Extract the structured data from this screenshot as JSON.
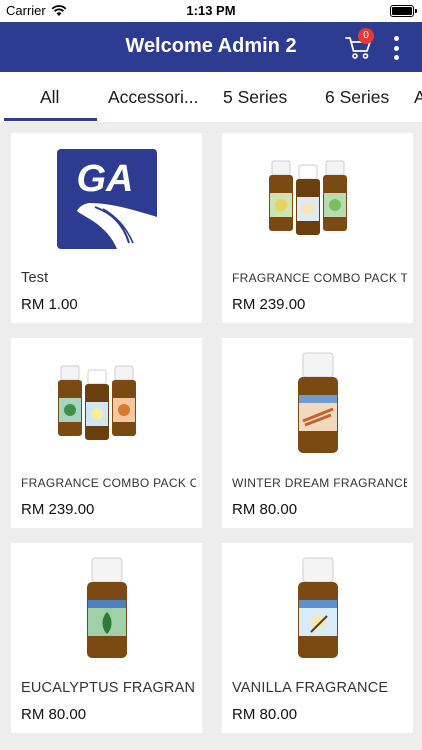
{
  "status_bar": {
    "carrier": "Carrier",
    "time": "1:13 PM"
  },
  "header": {
    "title": "Welcome Admin 2",
    "cart_count": "0"
  },
  "tabs": [
    {
      "label": "All"
    },
    {
      "label": "Accessori..."
    },
    {
      "label": "5 Series"
    },
    {
      "label": "6 Series"
    },
    {
      "label": "A"
    }
  ],
  "products": [
    {
      "name": "Test",
      "price": "RM 1.00",
      "logo_text": "GA"
    },
    {
      "name": "FRAGRANCE COMBO PACK TWO",
      "price": "RM 239.00"
    },
    {
      "name": "FRAGRANCE COMBO PACK ONE",
      "price": "RM 239.00"
    },
    {
      "name": "WINTER DREAM FRAGRANCE",
      "price": "RM 80.00"
    },
    {
      "name": "EUCALYPTUS FRAGRANCE",
      "price": "RM 80.00"
    },
    {
      "name": "VANILLA FRAGRANCE",
      "price": "RM 80.00"
    }
  ],
  "colors": {
    "primary": "#2d3c91",
    "badge": "#e53935"
  }
}
